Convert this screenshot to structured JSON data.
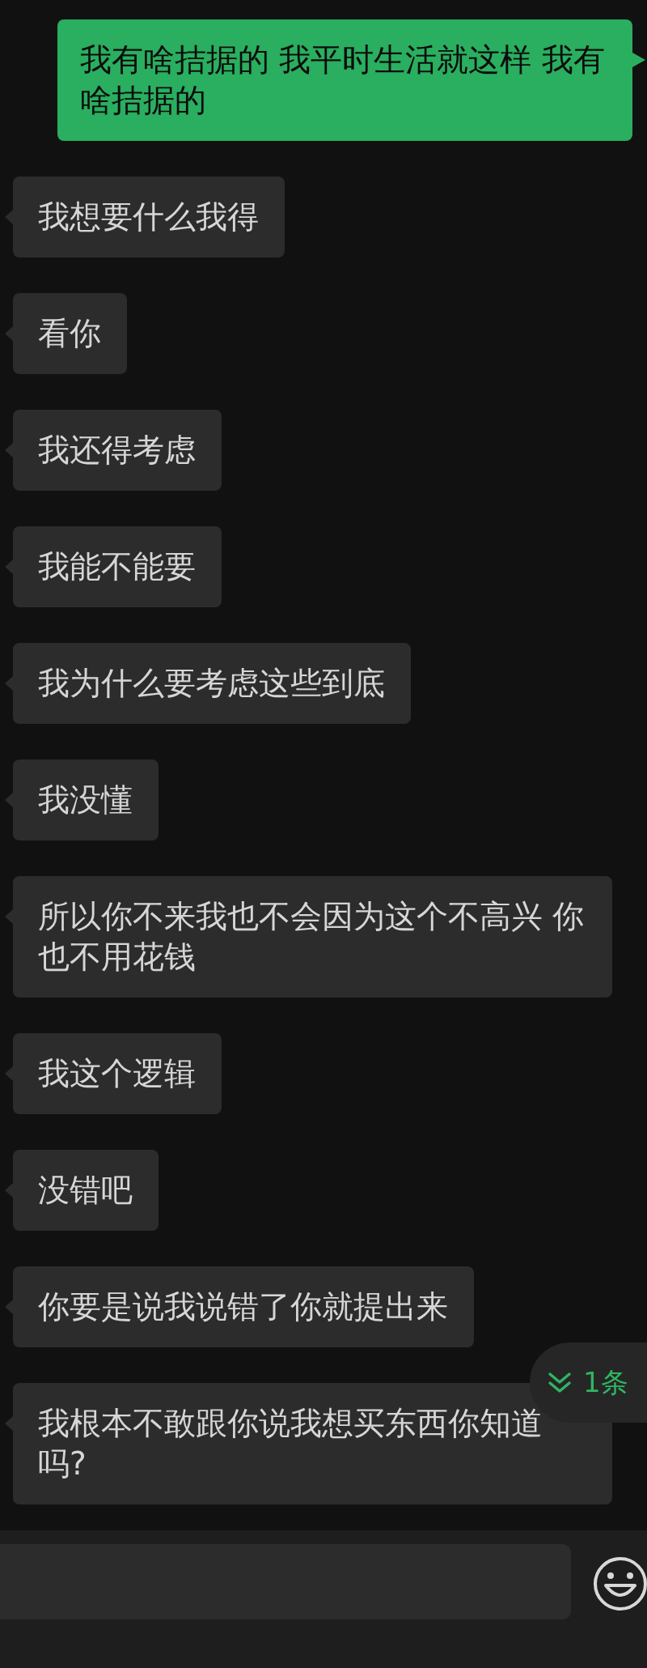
{
  "messages": [
    {
      "kind": "sent",
      "text": "我有啥拮据的 我平时生活就这样 我有啥拮据的"
    },
    {
      "kind": "received",
      "text": "我想要什么我得"
    },
    {
      "kind": "received",
      "text": "看你"
    },
    {
      "kind": "received",
      "text": "我还得考虑"
    },
    {
      "kind": "received",
      "text": "我能不能要"
    },
    {
      "kind": "received",
      "text": "我为什么要考虑这些到底"
    },
    {
      "kind": "received",
      "text": "我没懂"
    },
    {
      "kind": "received",
      "text": "所以你不来我也不会因为这个不高兴 你也不用花钱"
    },
    {
      "kind": "received",
      "text": "我这个逻辑"
    },
    {
      "kind": "received",
      "text": "没错吧"
    },
    {
      "kind": "received",
      "text": "你要是说我说错了你就提出来"
    },
    {
      "kind": "received",
      "text": "我根本不敢跟你说我想买东西你知道吗?"
    }
  ],
  "new_messages_pill": {
    "text": "1条"
  }
}
